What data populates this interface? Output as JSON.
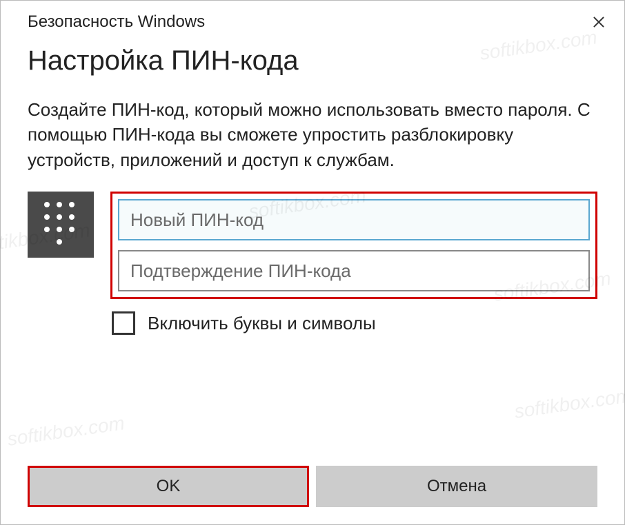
{
  "window": {
    "title": "Безопасность Windows"
  },
  "dialog": {
    "heading": "Настройка ПИН-кода",
    "description": "Создайте ПИН-код, который можно использовать вместо пароля. С помощью ПИН-кода вы сможете упростить разблокировку устройств, приложений и доступ к службам."
  },
  "inputs": {
    "new_pin_placeholder": "Новый ПИН-код",
    "confirm_pin_placeholder": "Подтверждение ПИН-кода"
  },
  "checkbox": {
    "label": "Включить буквы и символы"
  },
  "buttons": {
    "ok": "OK",
    "cancel": "Отмена"
  },
  "watermark": "softikbox.com"
}
